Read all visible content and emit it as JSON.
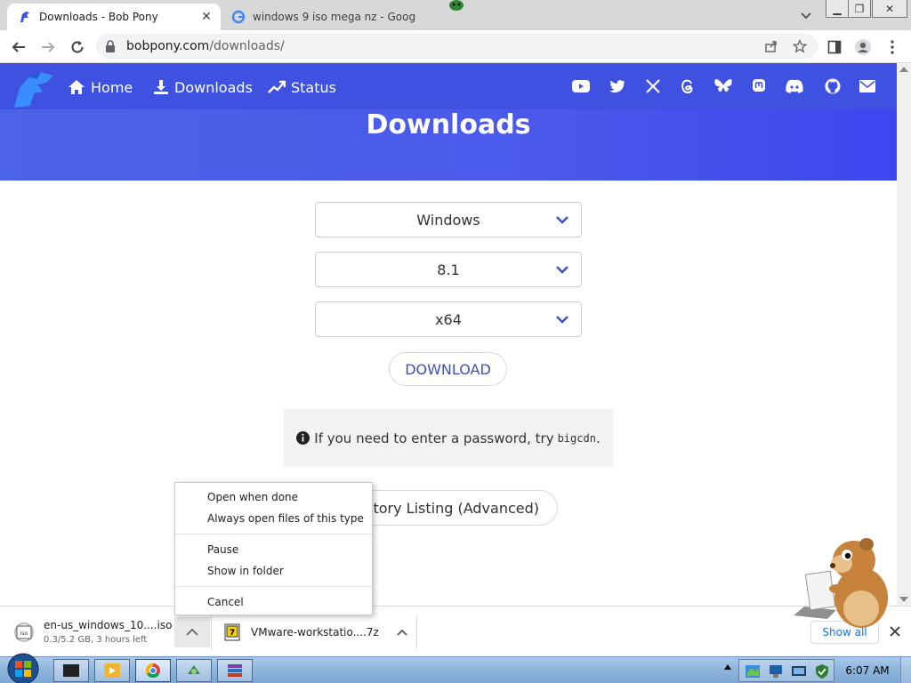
{
  "browser": {
    "tabs": [
      {
        "title": "Downloads - Bob Pony",
        "active": true
      },
      {
        "title": "windows 9 iso mega nz - Goog",
        "active": false
      }
    ],
    "url": {
      "host": "bobpony.com",
      "path": "/downloads/"
    }
  },
  "site": {
    "nav": {
      "home": "Home",
      "downloads": "Downloads",
      "status": "Status"
    },
    "social_icons": [
      "youtube-icon",
      "twitter-icon",
      "x-icon",
      "threads-icon",
      "bluesky-icon",
      "mastodon-icon",
      "discord-icon",
      "github-icon",
      "email-icon"
    ],
    "brand_color": "#3f51e0"
  },
  "page": {
    "title": "Downloads",
    "selects": {
      "os": "Windows",
      "version": "8.1",
      "arch": "x64"
    },
    "download_button": "DOWNLOAD",
    "notice": {
      "text": "If you need to enter a password, try",
      "password": "bigcdn",
      "suffix": "."
    },
    "directory_button": "ectory Listing (Advanced)"
  },
  "context_menu": {
    "items": [
      "Open when done",
      "Always open files of this type",
      "Pause",
      "Show in folder",
      "Cancel"
    ]
  },
  "download_shelf": {
    "items": [
      {
        "name": "en-us_windows_10....iso",
        "status": "0.3/5.2 GB, 3 hours left"
      },
      {
        "name": "VMware-workstatio....7z",
        "status": ""
      }
    ],
    "show_all": "Show all"
  },
  "taskbar": {
    "clock": "6:07 AM"
  }
}
